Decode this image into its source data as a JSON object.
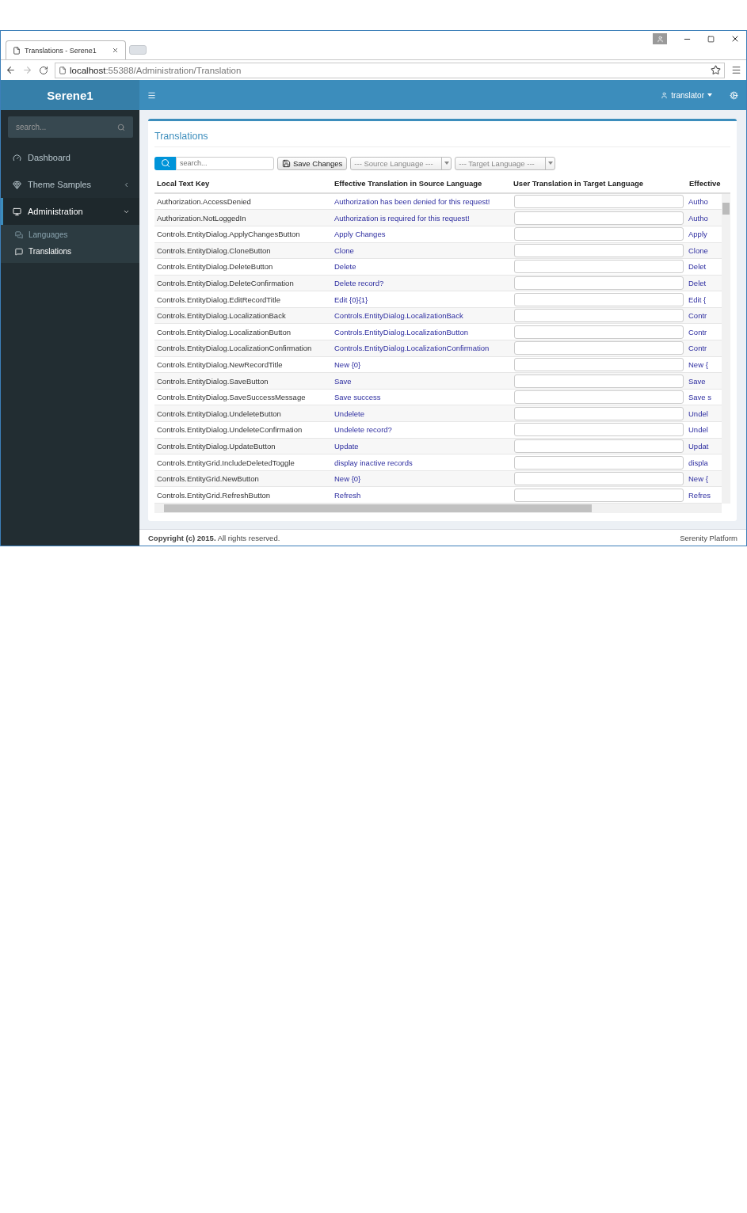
{
  "browser": {
    "tab_title": "Translations - Serene1",
    "url_host": "localhost",
    "url_path": ":55388/Administration/Translation"
  },
  "header": {
    "logo": "Serene1",
    "user": "translator"
  },
  "sidebar": {
    "search_placeholder": "search...",
    "items": [
      {
        "label": "Dashboard",
        "selected": false
      },
      {
        "label": "Theme Samples",
        "selected": false,
        "expanded": false
      },
      {
        "label": "Administration",
        "selected": true,
        "expanded": true,
        "children": [
          {
            "label": "Languages",
            "selected": false
          },
          {
            "label": "Translations",
            "selected": true
          }
        ]
      }
    ]
  },
  "panel": {
    "title": "Translations",
    "search_placeholder": "search...",
    "save_button": "Save Changes",
    "source_select": "--- Source Language ---",
    "target_select": "--- Target Language ---"
  },
  "table": {
    "columns": [
      "Local Text Key",
      "Effective Translation in Source Language",
      "User Translation in Target Language",
      "Effective"
    ],
    "rows": [
      {
        "key": "Authorization.AccessDenied",
        "source": "Authorization has been denied for this request!",
        "effective": "Autho"
      },
      {
        "key": "Authorization.NotLoggedIn",
        "source": "Authorization is required for this request!",
        "effective": "Autho"
      },
      {
        "key": "Controls.EntityDialog.ApplyChangesButton",
        "source": "Apply Changes",
        "effective": "Apply"
      },
      {
        "key": "Controls.EntityDialog.CloneButton",
        "source": "Clone",
        "effective": "Clone"
      },
      {
        "key": "Controls.EntityDialog.DeleteButton",
        "source": "Delete",
        "effective": "Delet"
      },
      {
        "key": "Controls.EntityDialog.DeleteConfirmation",
        "source": "Delete record?",
        "effective": "Delet"
      },
      {
        "key": "Controls.EntityDialog.EditRecordTitle",
        "source": "Edit {0}{1}",
        "effective": "Edit {"
      },
      {
        "key": "Controls.EntityDialog.LocalizationBack",
        "source": "Controls.EntityDialog.LocalizationBack",
        "effective": "Contr"
      },
      {
        "key": "Controls.EntityDialog.LocalizationButton",
        "source": "Controls.EntityDialog.LocalizationButton",
        "effective": "Contr"
      },
      {
        "key": "Controls.EntityDialog.LocalizationConfirmation",
        "source": "Controls.EntityDialog.LocalizationConfirmation",
        "effective": "Contr"
      },
      {
        "key": "Controls.EntityDialog.NewRecordTitle",
        "source": "New {0}",
        "effective": "New {"
      },
      {
        "key": "Controls.EntityDialog.SaveButton",
        "source": "Save",
        "effective": "Save"
      },
      {
        "key": "Controls.EntityDialog.SaveSuccessMessage",
        "source": "Save success",
        "effective": "Save s"
      },
      {
        "key": "Controls.EntityDialog.UndeleteButton",
        "source": "Undelete",
        "effective": "Undel"
      },
      {
        "key": "Controls.EntityDialog.UndeleteConfirmation",
        "source": "Undelete record?",
        "effective": "Undel"
      },
      {
        "key": "Controls.EntityDialog.UpdateButton",
        "source": "Update",
        "effective": "Updat"
      },
      {
        "key": "Controls.EntityGrid.IncludeDeletedToggle",
        "source": "display inactive records",
        "effective": "displa"
      },
      {
        "key": "Controls.EntityGrid.NewButton",
        "source": "New {0}",
        "effective": "New {"
      },
      {
        "key": "Controls.EntityGrid.RefreshButton",
        "source": "Refresh",
        "effective": "Refres"
      }
    ]
  },
  "footer": {
    "copyright": "**Copyright (c) 2015.** All rights reserved.",
    "platform": "Serenity Platform"
  }
}
